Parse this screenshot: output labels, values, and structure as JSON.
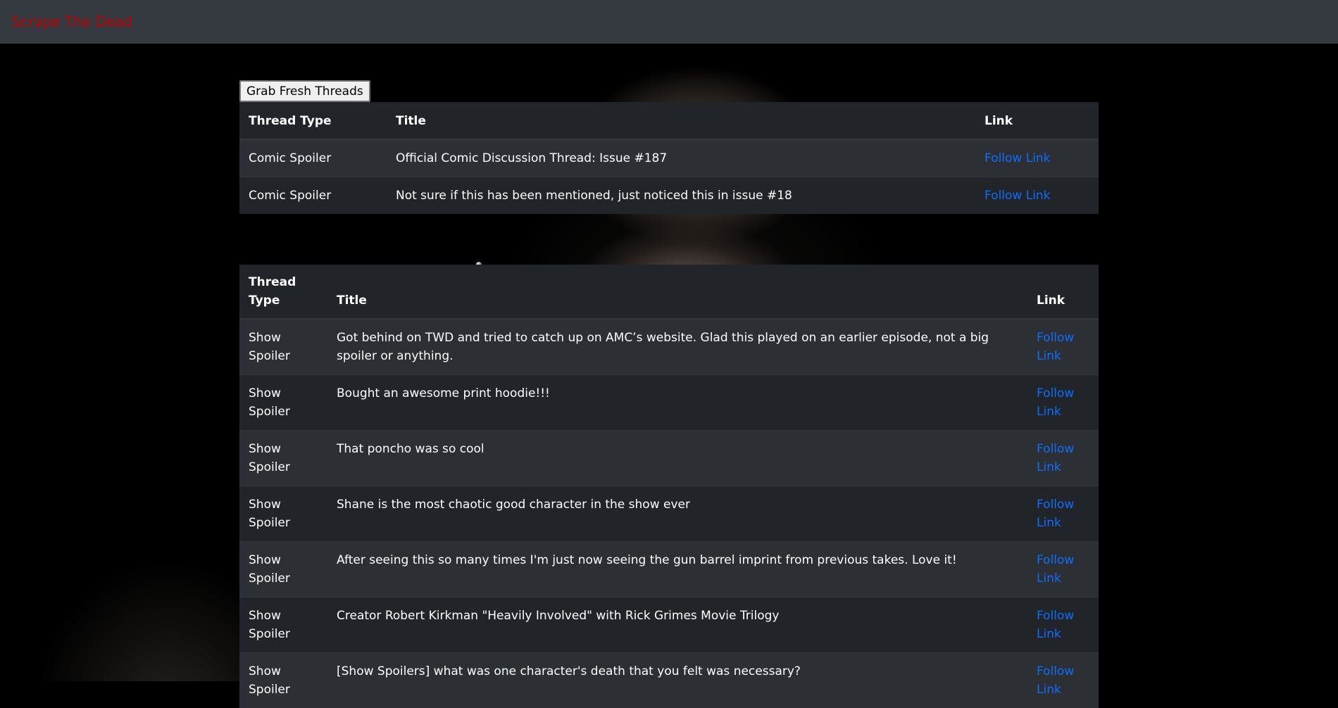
{
  "navbar": {
    "brand": "Scrape The Dead",
    "brand_color": "#c00000"
  },
  "toolbar": {
    "grab_label": "Grab Fresh Threads"
  },
  "comic_table": {
    "headers": [
      "Thread Type",
      "Title",
      "Link"
    ],
    "rows": [
      {
        "type": "Comic Spoiler",
        "title": "Official Comic Discussion Thread: Issue #187",
        "link": "Follow Link"
      },
      {
        "type": "Comic Spoiler",
        "title": "Not sure if this has been mentioned, just noticed this in issue #18",
        "link": "Follow Link"
      }
    ]
  },
  "show_table": {
    "headers": [
      "Thread Type",
      "Title",
      "Link"
    ],
    "rows": [
      {
        "type": "Show Spoiler",
        "title": "Got behind on TWD and tried to catch up on AMC’s website. Glad this played on an earlier episode, not a big spoiler or anything.",
        "link": "Follow Link"
      },
      {
        "type": "Show Spoiler",
        "title": "Bought an awesome print hoodie!!!",
        "link": "Follow Link"
      },
      {
        "type": "Show Spoiler",
        "title": "That poncho was so cool",
        "link": "Follow Link"
      },
      {
        "type": "Show Spoiler",
        "title": "Shane is the most chaotic good character in the show ever",
        "link": "Follow Link"
      },
      {
        "type": "Show Spoiler",
        "title": "After seeing this so many times I'm just now seeing the gun barrel imprint from previous takes. Love it!",
        "link": "Follow Link"
      },
      {
        "type": "Show Spoiler",
        "title": "Creator Robert Kirkman \"Heavily Involved\" with Rick Grimes Movie Trilogy",
        "link": "Follow Link"
      },
      {
        "type": "Show Spoiler",
        "title": "[Show Spoilers] what was one character's death that you felt was necessary?",
        "link": "Follow Link"
      }
    ]
  },
  "colors": {
    "navbar_bg": "#343a40",
    "table_dark": "#212529",
    "table_striped": "#2c3034",
    "link": "#0d6efd"
  }
}
